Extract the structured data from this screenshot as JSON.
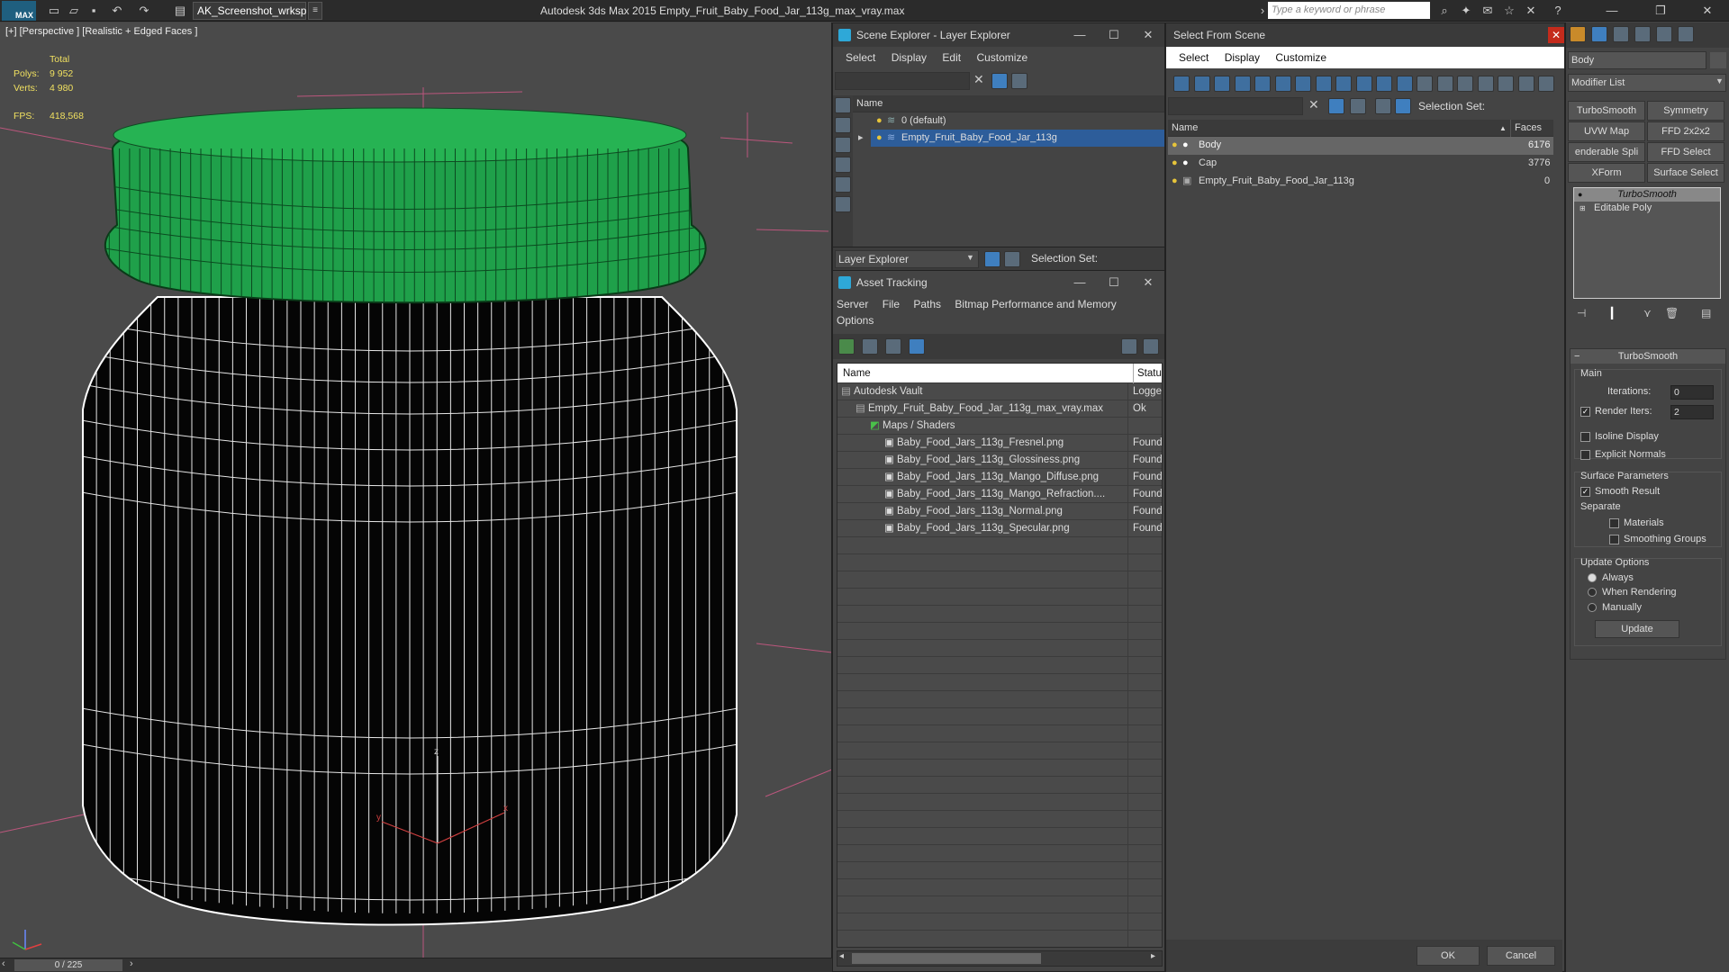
{
  "app": {
    "logo_text": "MAX",
    "workspace": "AK_Screenshot_wrksp",
    "title": "Autodesk 3ds Max  2015    Empty_Fruit_Baby_Food_Jar_113g_max_vray.max",
    "search_placeholder": "Type a keyword or phrase"
  },
  "viewport": {
    "label": "[+] [Perspective ] [Realistic + Edged Faces ]",
    "stats": {
      "total_label": "Total",
      "polys_label": "Polys:",
      "polys_value": "9 952",
      "verts_label": "Verts:",
      "verts_value": "4 980",
      "fps_label": "FPS:",
      "fps_value": "418,568"
    },
    "colors": {
      "cap": "#1fa04a",
      "jar": "#050505",
      "wire": "#ffffff",
      "bg": "#4a4a4a"
    }
  },
  "statusbar": {
    "frame": "0 / 225"
  },
  "scene_explorer": {
    "title": "Scene Explorer - Layer Explorer",
    "menu": [
      "Select",
      "Display",
      "Edit",
      "Customize"
    ],
    "column": "Name",
    "rows": [
      {
        "label": "0 (default)"
      },
      {
        "label": "Empty_Fruit_Baby_Food_Jar_113g"
      }
    ],
    "footer_dropdown": "Layer Explorer",
    "selection_set_label": "Selection Set:"
  },
  "asset_tracking": {
    "title": "Asset Tracking",
    "menu": [
      "Server",
      "File",
      "Paths",
      "Bitmap Performance and Memory",
      "Options"
    ],
    "columns": {
      "name": "Name",
      "status": "Status"
    },
    "rows": [
      {
        "name": "Autodesk Vault",
        "status": "Logged",
        "indent": 0
      },
      {
        "name": "Empty_Fruit_Baby_Food_Jar_113g_max_vray.max",
        "status": "Ok",
        "indent": 1
      },
      {
        "name": "Maps / Shaders",
        "status": "",
        "indent": 2
      },
      {
        "name": "Baby_Food_Jars_113g_Fresnel.png",
        "status": "Found",
        "indent": 3
      },
      {
        "name": "Baby_Food_Jars_113g_Glossiness.png",
        "status": "Found",
        "indent": 3
      },
      {
        "name": "Baby_Food_Jars_113g_Mango_Diffuse.png",
        "status": "Found",
        "indent": 3
      },
      {
        "name": "Baby_Food_Jars_113g_Mango_Refraction....",
        "status": "Found",
        "indent": 3
      },
      {
        "name": "Baby_Food_Jars_113g_Normal.png",
        "status": "Found",
        "indent": 3
      },
      {
        "name": "Baby_Food_Jars_113g_Specular.png",
        "status": "Found",
        "indent": 3
      }
    ]
  },
  "select_from_scene": {
    "title": "Select From Scene",
    "menu": [
      "Select",
      "Display",
      "Customize"
    ],
    "selection_set_label": "Selection Set:",
    "columns": {
      "name": "Name",
      "faces": "Faces"
    },
    "rows": [
      {
        "name": "Body",
        "faces": "6176"
      },
      {
        "name": "Cap",
        "faces": "3776"
      },
      {
        "name": "Empty_Fruit_Baby_Food_Jar_113g",
        "faces": "0"
      }
    ],
    "ok": "OK",
    "cancel": "Cancel"
  },
  "command_panel": {
    "object_name": "Body",
    "modifier_list": "Modifier List",
    "buttons": [
      "TurboSmooth",
      "Symmetry",
      "UVW Map",
      "FFD 2x2x2",
      "enderable Spli",
      "FFD Select",
      "XForm",
      "Surface Select"
    ],
    "stack": [
      "TurboSmooth",
      "Editable Poly"
    ],
    "rollout_title": "TurboSmooth",
    "main_label": "Main",
    "iterations_label": "Iterations:",
    "iterations_value": "0",
    "render_iters_label": "Render Iters:",
    "render_iters_value": "2",
    "isoline": "Isoline Display",
    "explicit_normals": "Explicit Normals",
    "surface_params": "Surface Parameters",
    "smooth_result": "Smooth Result",
    "separate": "Separate",
    "materials": "Materials",
    "smoothing_groups": "Smoothing Groups",
    "update_options": "Update Options",
    "always": "Always",
    "when_rendering": "When Rendering",
    "manually": "Manually",
    "update": "Update"
  }
}
